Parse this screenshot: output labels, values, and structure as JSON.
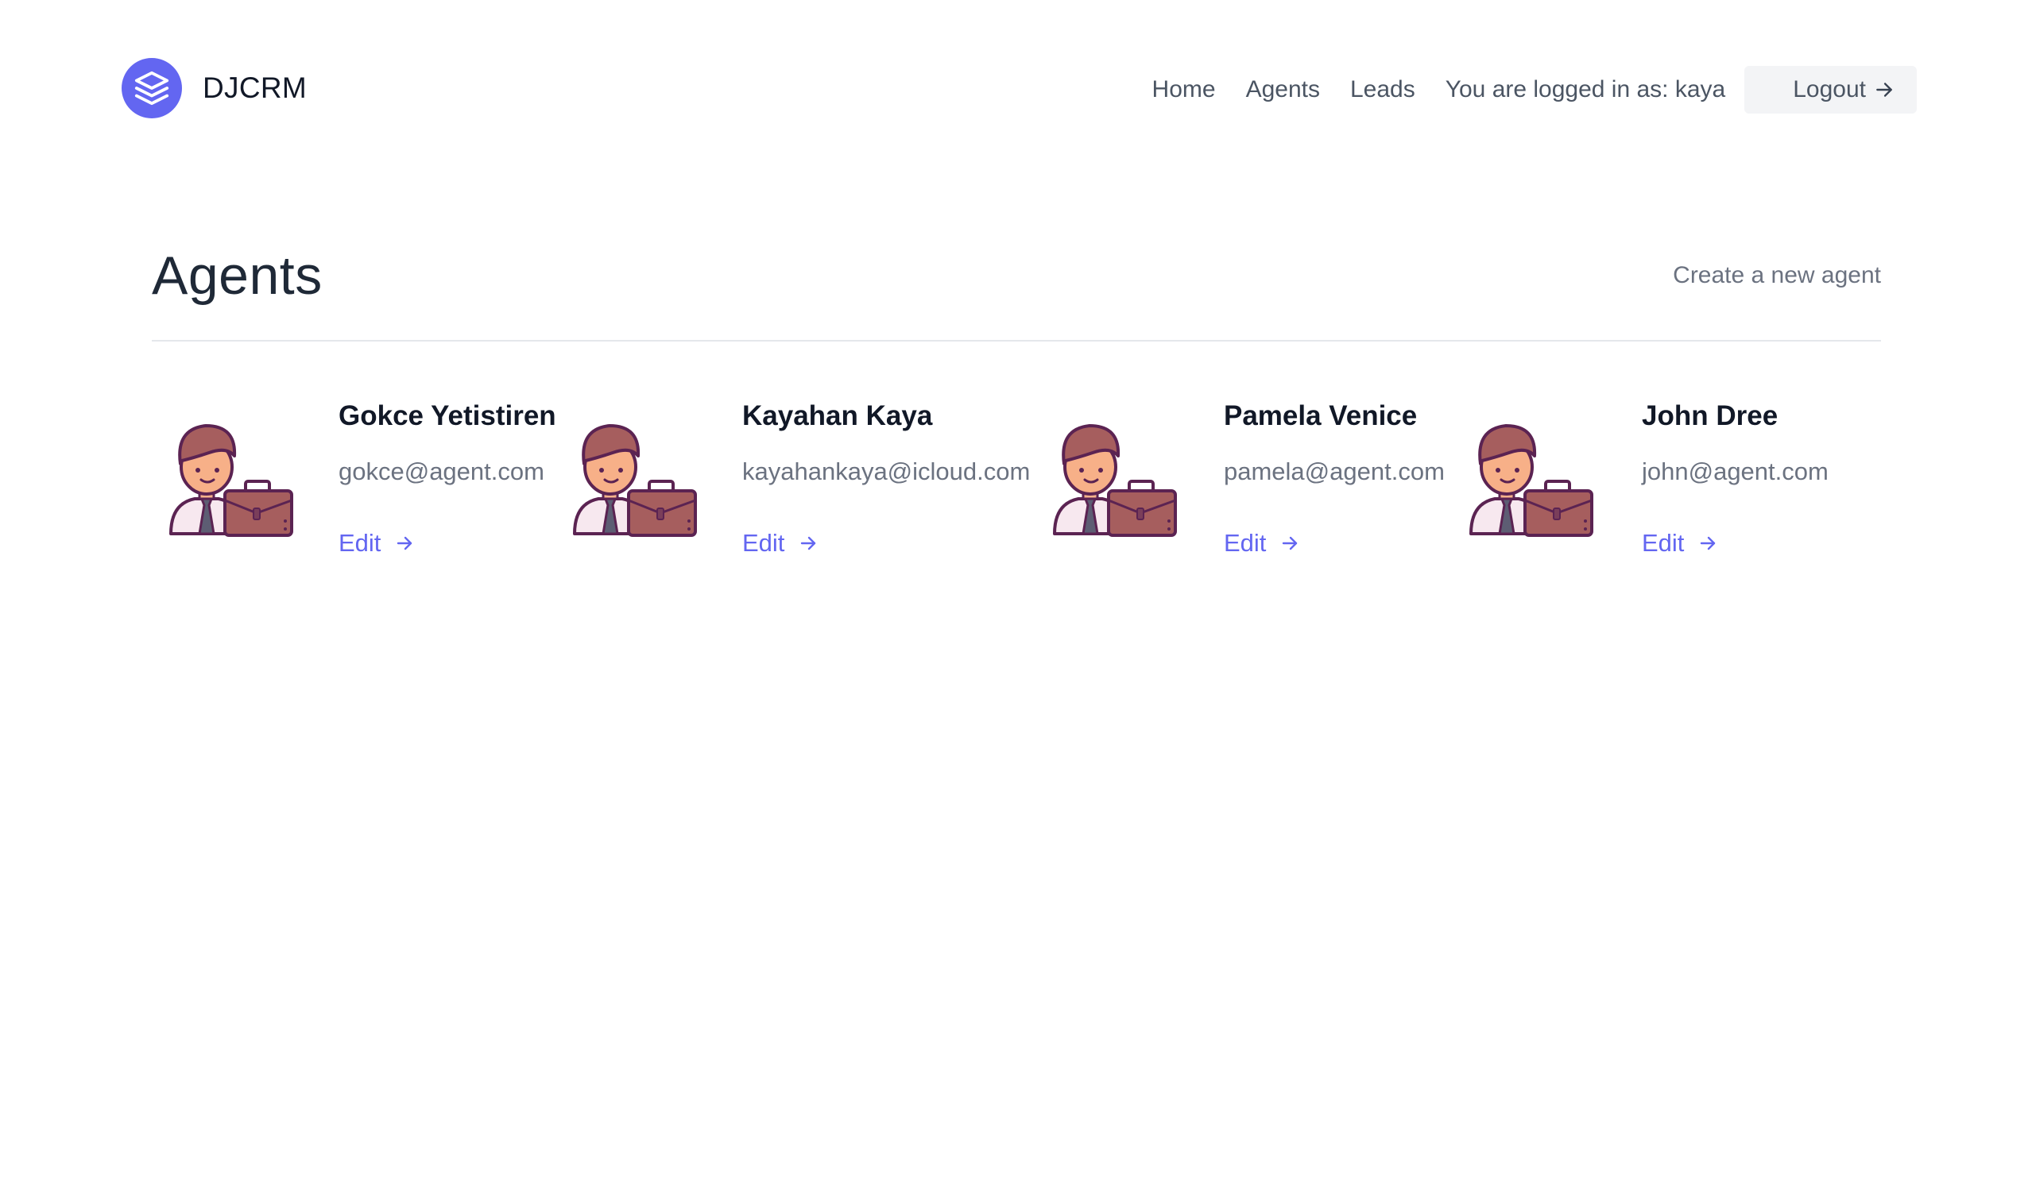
{
  "brand": {
    "name": "DJCRM",
    "accent_color": "#6366f1",
    "logo_icon": "layers-icon"
  },
  "nav": {
    "home": "Home",
    "agents": "Agents",
    "leads": "Leads",
    "logged_in_text": "You are logged in as: kaya",
    "logout": "Logout"
  },
  "page": {
    "title": "Agents",
    "create_link": "Create a new agent"
  },
  "agents": [
    {
      "name": "Gokce Yetistiren",
      "email": "gokce@agent.com",
      "edit_label": "Edit"
    },
    {
      "name": "Kayahan Kaya",
      "email": "kayahankaya@icloud.com",
      "edit_label": "Edit"
    },
    {
      "name": "Pamela Venice",
      "email": "pamela@agent.com",
      "edit_label": "Edit"
    },
    {
      "name": "John Dree",
      "email": "john@agent.com",
      "edit_label": "Edit"
    }
  ]
}
